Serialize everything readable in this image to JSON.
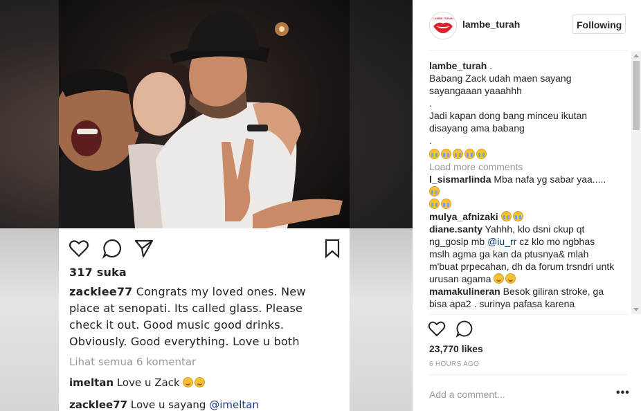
{
  "photo_post": {
    "likes_text": "317 suka",
    "caption_user": "zacklee77",
    "caption_text": "Congrats my loved ones. New place at senopati. Its called glass. Please check it out. Good music good drinks. Obviously. Good everything. Love u both",
    "view_all_comments": "Lihat semua 6 komentar",
    "comments": [
      {
        "user": "imeltan",
        "text": "Love u Zack"
      },
      {
        "user": "zacklee77",
        "text": "Love u sayang",
        "mention": "@imeltan"
      }
    ]
  },
  "header": {
    "username": "lambe_turah",
    "follow_label": "Following",
    "avatar_text": "LAMBE TURAH"
  },
  "caption": {
    "user": "lambe_turah",
    "user_suffix": " .",
    "line1": "Babang Zack udah maen sayang sayangaaan yaaahhh",
    "dot1": ".",
    "line2": "Jadi kapan dong bang minceu ikutan disayang ama babang",
    "dot2": "."
  },
  "load_more": "Load more comments",
  "comments": [
    {
      "user": "l_sismarlinda",
      "text": "Mba nafa yg sabar yaa....."
    },
    {
      "user": "mulya_afnizaki",
      "text": ""
    },
    {
      "user": "diane.santy",
      "text_a": "Yahhh, klo dsni ckup qt ng_gosip mb",
      "mention": "@iu_rr",
      "text_b": "cz klo mo ngbhas mslh agma ga kan da ptusnya& mlah m'buat prpecahan, dh da forum trsndri untk urusan agama"
    },
    {
      "user": "mamakulineran",
      "text": "Besok giliran stroke, ga bisa apa2 . surinya pafasa karena"
    }
  ],
  "likes": "23,770 likes",
  "time_ago": "6 HOURS AGO",
  "add_comment_placeholder": "Add a comment...",
  "more_options": "•••",
  "icons": [
    "heart-icon",
    "comment-icon",
    "share-icon",
    "bookmark-icon",
    "more-options-icon"
  ],
  "colors": {
    "link": "#003569",
    "muted": "#999999",
    "text": "#262626",
    "avatar_red": "#d9232a"
  }
}
